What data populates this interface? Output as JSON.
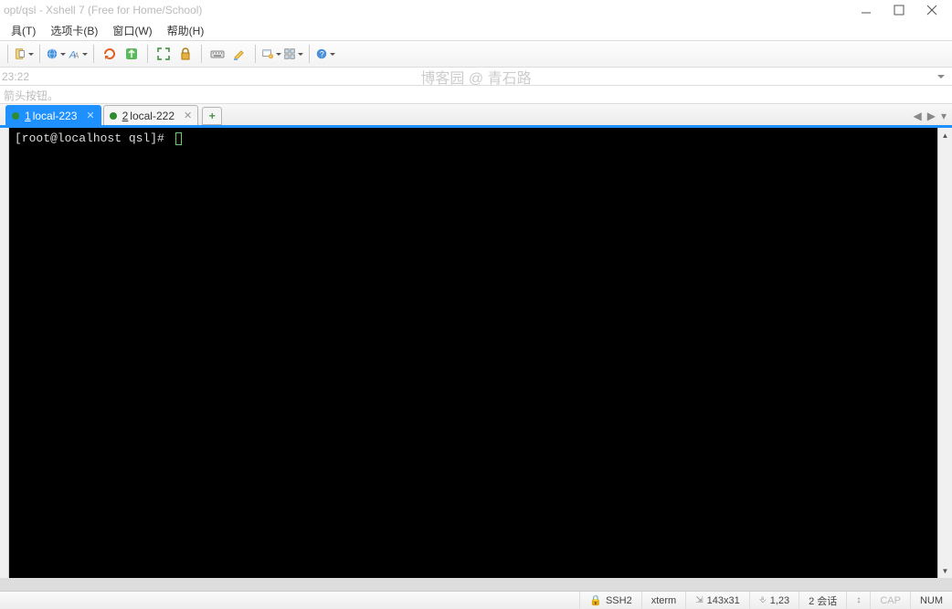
{
  "window": {
    "title": "opt/qsl - Xshell 7 (Free for Home/School)"
  },
  "menu": {
    "items": [
      "具(T)",
      "选项卡(B)",
      "窗口(W)",
      "帮助(H)"
    ]
  },
  "address": {
    "text": "23:22",
    "watermark": "博客园 @ 青石路"
  },
  "hint": {
    "text": "箭头按钮。"
  },
  "tabs": [
    {
      "num": "1",
      "label": "local-223",
      "active": true
    },
    {
      "num": "2",
      "label": "local-222",
      "active": false
    }
  ],
  "tab_add": "+",
  "terminal": {
    "prompt": "[root@localhost qsl]# "
  },
  "status": {
    "protocol": "SSH2",
    "termtype": "xterm",
    "dimensions": "143x31",
    "cursor": "1,23",
    "sessions": "2 会话",
    "cap": "CAP",
    "num": "NUM"
  },
  "toolbar_dropdown_arrow": "▾"
}
